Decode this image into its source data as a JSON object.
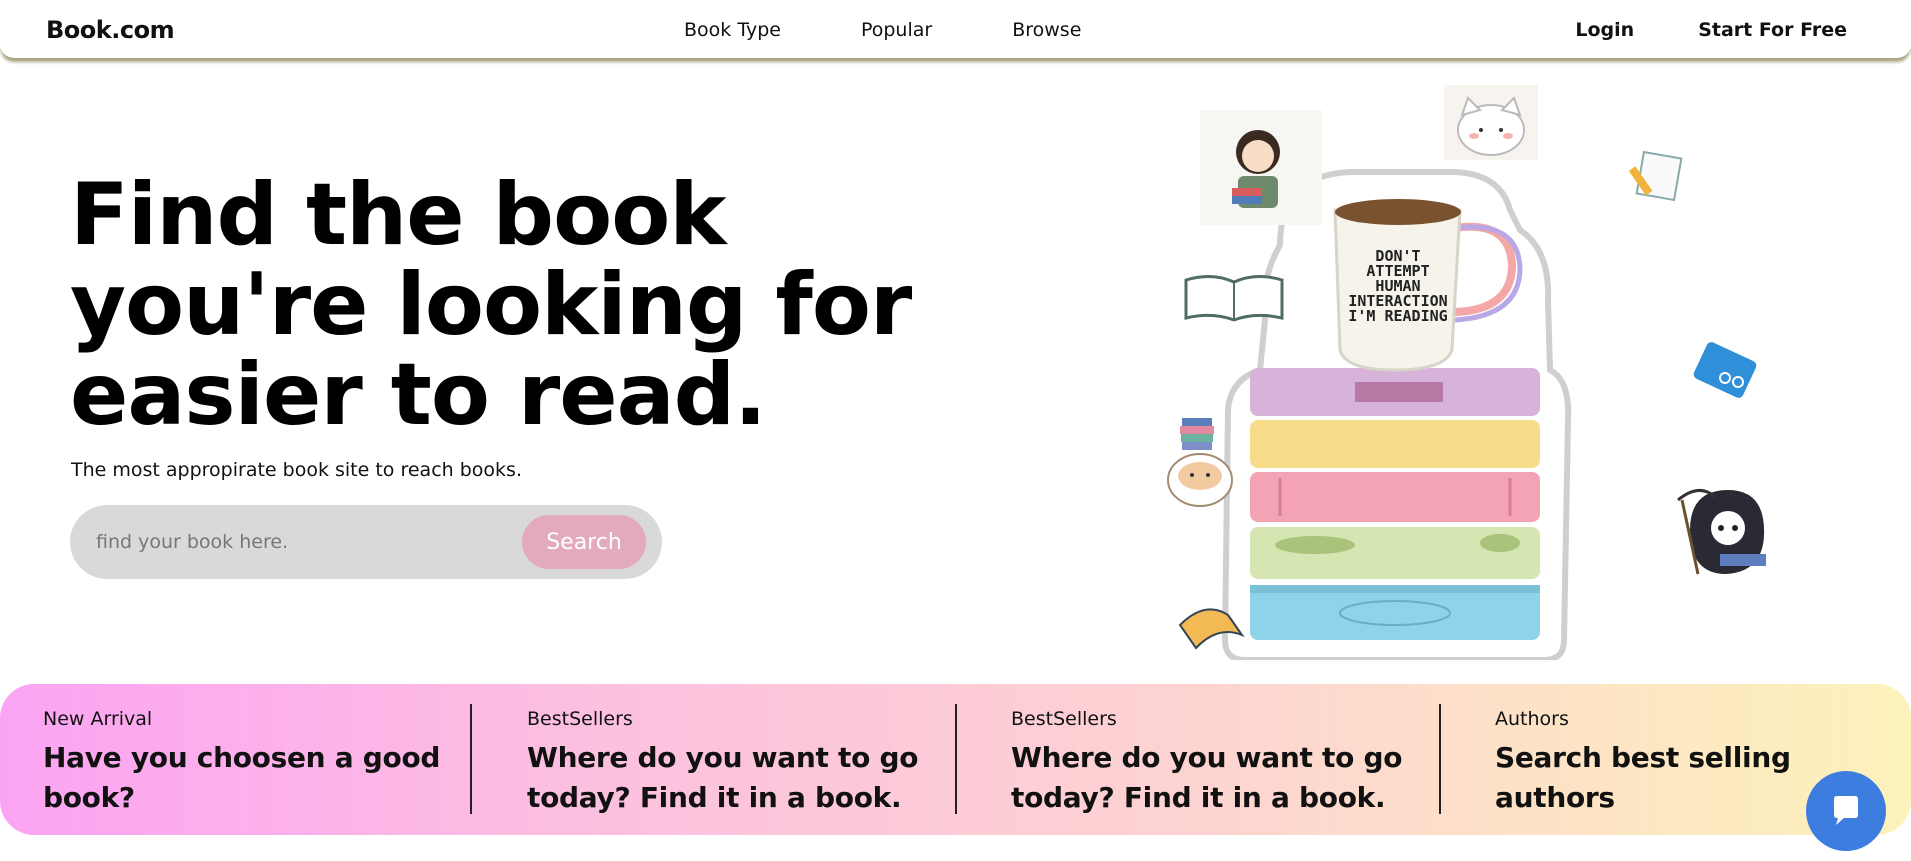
{
  "nav": {
    "brand": "Book.com",
    "links": [
      "Book Type",
      "Popular",
      "Browse"
    ],
    "login": "Login",
    "start": "Start For Free"
  },
  "hero": {
    "title": "Find the book you're looking for easier to read.",
    "subtitle": "The most appropirate book site to reach books.",
    "search_placeholder": "find your book here.",
    "search_button": "Search"
  },
  "illustration": {
    "mug_text": [
      "DON'T",
      "ATTEMPT",
      "HUMAN",
      "INTERACTION",
      "I'M READING"
    ]
  },
  "cards": [
    {
      "label": "New Arrival",
      "heading_line1": "Have you choosen a good",
      "heading_line2": "book?"
    },
    {
      "label": "BestSellers",
      "heading_line1": "Where do you want to go",
      "heading_line2": "today? Find it in a book."
    },
    {
      "label": "BestSellers",
      "heading_line1": "Where do you want to go",
      "heading_line2": "today? Find it in a book."
    },
    {
      "label": "Authors",
      "heading_line1": "Search best selling authors",
      "heading_line2": ""
    }
  ],
  "colors": {
    "search_button": "#e3aabd",
    "chat_button": "#3d7de0",
    "strip_start": "#fca4f4",
    "strip_end": "#fdf2bb"
  },
  "icons": {
    "chat": "chat-bubble-icon"
  }
}
